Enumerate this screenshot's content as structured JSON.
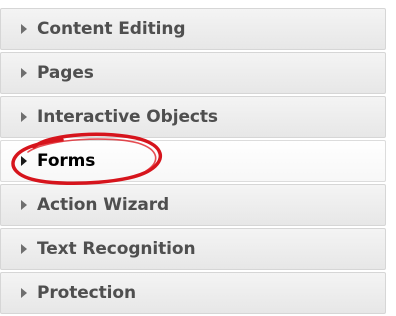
{
  "panel": {
    "items": [
      {
        "label": "Content Editing",
        "active": false
      },
      {
        "label": "Pages",
        "active": false
      },
      {
        "label": "Interactive Objects",
        "active": false
      },
      {
        "label": "Forms",
        "active": true
      },
      {
        "label": "Action Wizard",
        "active": false
      },
      {
        "label": "Text Recognition",
        "active": false
      },
      {
        "label": "Protection",
        "active": false
      }
    ]
  },
  "annotation": {
    "type": "hand-drawn circle",
    "target": "Forms",
    "color": "#d6141c"
  }
}
